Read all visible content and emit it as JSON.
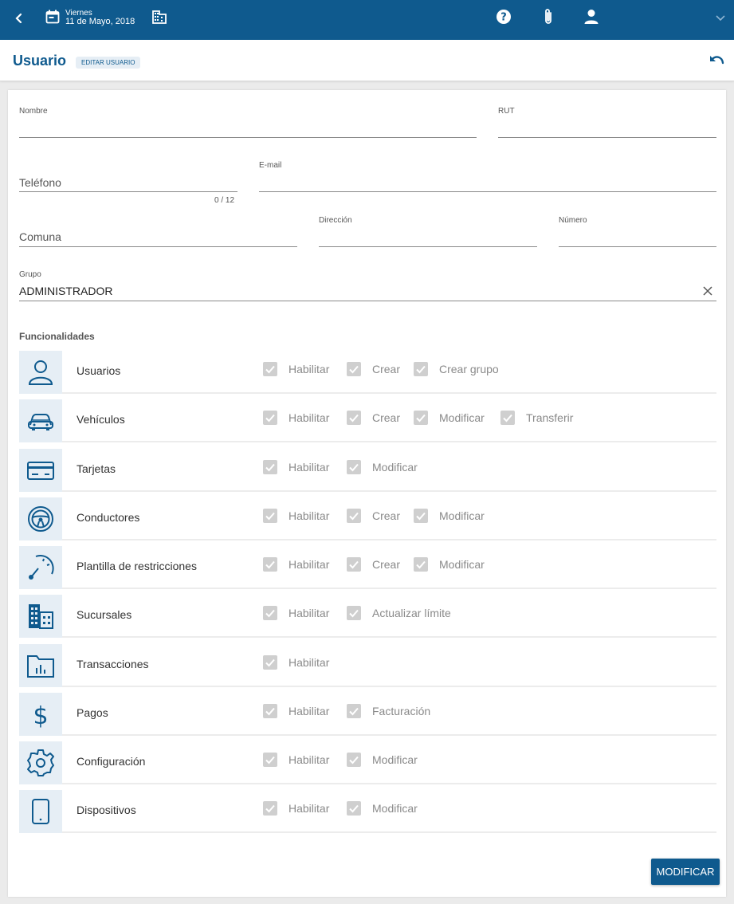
{
  "topbar": {
    "day": "Viernes",
    "date": "11 de Mayo, 2018"
  },
  "header": {
    "title": "Usuario",
    "badge": "EDITAR USUARIO"
  },
  "form": {
    "nombre_label": "Nombre",
    "rut_label": "RUT",
    "telefono_label": "Teléfono",
    "telefono_counter": "0 / 12",
    "email_label": "E-mail",
    "comuna_label": "Comuna",
    "direccion_label": "Dirección",
    "numero_label": "Número",
    "grupo_label": "Grupo",
    "grupo_value": "ADMINISTRADOR"
  },
  "funcionalidades": {
    "title": "Funcionalidades",
    "rows": [
      {
        "name": "Usuarios",
        "icon": "user-icon",
        "options": [
          "Habilitar",
          "Crear",
          "Crear grupo"
        ]
      },
      {
        "name": "Vehículos",
        "icon": "car-icon",
        "options": [
          "Habilitar",
          "Crear",
          "Modificar",
          "Transferir"
        ]
      },
      {
        "name": "Tarjetas",
        "icon": "credit-card-icon",
        "options": [
          "Habilitar",
          "Modificar"
        ]
      },
      {
        "name": "Conductores",
        "icon": "steering-wheel-icon",
        "options": [
          "Habilitar",
          "Crear",
          "Modificar"
        ]
      },
      {
        "name": "Plantilla de restricciones",
        "icon": "gauge-icon",
        "options": [
          "Habilitar",
          "Crear",
          "Modificar"
        ]
      },
      {
        "name": "Sucursales",
        "icon": "building-icon",
        "options": [
          "Habilitar",
          "Actualizar límite"
        ]
      },
      {
        "name": "Transacciones",
        "icon": "folder-chart-icon",
        "options": [
          "Habilitar"
        ]
      },
      {
        "name": "Pagos",
        "icon": "dollar-icon",
        "options": [
          "Habilitar",
          "Facturación"
        ]
      },
      {
        "name": "Configuración",
        "icon": "gear-icon",
        "options": [
          "Habilitar",
          "Modificar"
        ]
      },
      {
        "name": "Dispositivos",
        "icon": "tablet-icon",
        "options": [
          "Habilitar",
          "Modificar"
        ]
      }
    ]
  },
  "actions": {
    "modify_label": "MODIFICAR"
  },
  "colors": {
    "primary": "#0f5a8e",
    "icon_bg": "#e6eef5",
    "checkbox_disabled": "#cfcfcf"
  }
}
